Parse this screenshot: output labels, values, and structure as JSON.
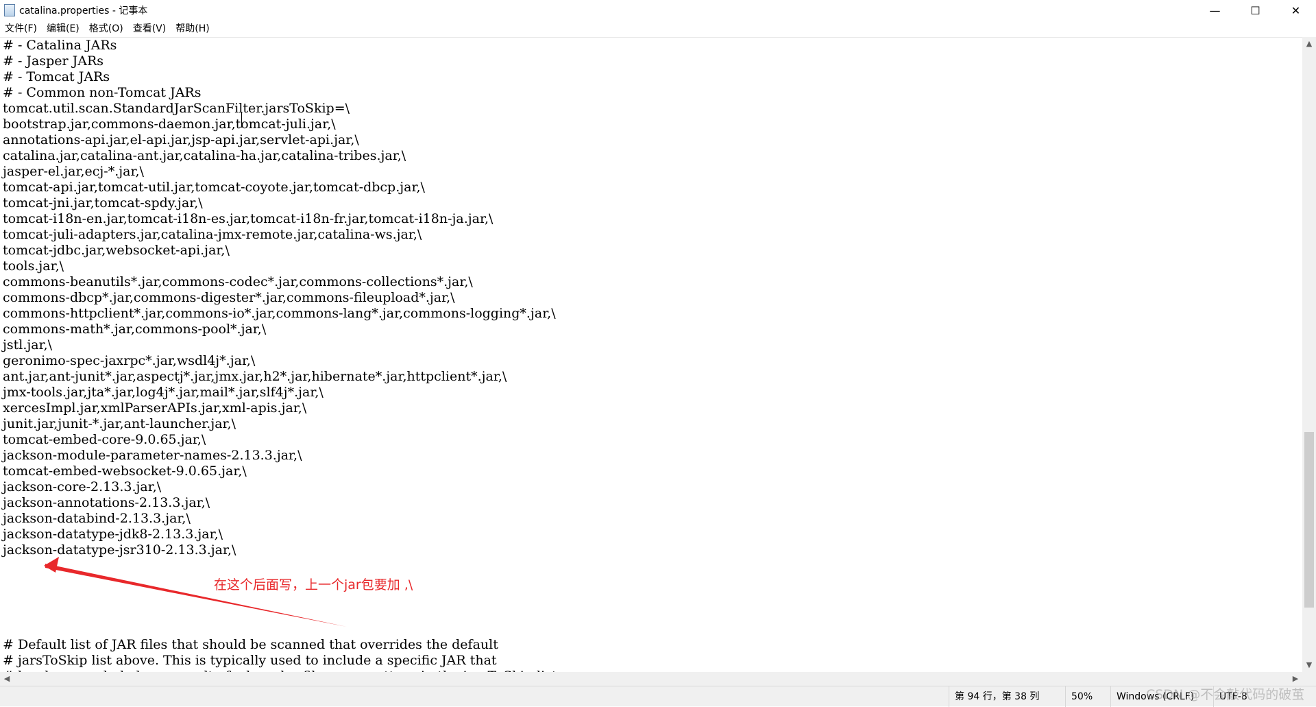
{
  "window": {
    "title": "catalina.properties - 记事本",
    "controls": {
      "minimize": "—",
      "maximize": "☐",
      "close": "✕"
    }
  },
  "menu": [
    {
      "label": "文件(F)"
    },
    {
      "label": "编辑(E)"
    },
    {
      "label": "格式(O)"
    },
    {
      "label": "查看(V)"
    },
    {
      "label": "帮助(H)"
    }
  ],
  "editor": {
    "lines": [
      "# - Catalina JARs",
      "# - Jasper JARs",
      "# - Tomcat JARs",
      "# - Common non-Tomcat JARs",
      "tomcat.util.scan.StandardJarScanFilter.jarsToSkip=\\",
      "bootstrap.jar,commons-daemon.jar,tomcat-juli.jar,\\",
      "annotations-api.jar,el-api.jar,jsp-api.jar,servlet-api.jar,\\",
      "catalina.jar,catalina-ant.jar,catalina-ha.jar,catalina-tribes.jar,\\",
      "jasper-el.jar,ecj-*.jar,\\",
      "tomcat-api.jar,tomcat-util.jar,tomcat-coyote.jar,tomcat-dbcp.jar,\\",
      "tomcat-jni.jar,tomcat-spdy.jar,\\",
      "tomcat-i18n-en.jar,tomcat-i18n-es.jar,tomcat-i18n-fr.jar,tomcat-i18n-ja.jar,\\",
      "tomcat-juli-adapters.jar,catalina-jmx-remote.jar,catalina-ws.jar,\\",
      "tomcat-jdbc.jar,websocket-api.jar,\\",
      "tools.jar,\\",
      "commons-beanutils*.jar,commons-codec*.jar,commons-collections*.jar,\\",
      "commons-dbcp*.jar,commons-digester*.jar,commons-fileupload*.jar,\\",
      "commons-httpclient*.jar,commons-io*.jar,commons-lang*.jar,commons-logging*.jar,\\",
      "commons-math*.jar,commons-pool*.jar,\\",
      "jstl.jar,\\",
      "geronimo-spec-jaxrpc*.jar,wsdl4j*.jar,\\",
      "ant.jar,ant-junit*.jar,aspectj*.jar,jmx.jar,h2*.jar,hibernate*.jar,httpclient*.jar,\\",
      "jmx-tools.jar,jta*.jar,log4j*.jar,mail*.jar,slf4j*.jar,\\",
      "xercesImpl.jar,xmlParserAPIs.jar,xml-apis.jar,\\",
      "junit.jar,junit-*.jar,ant-launcher.jar,\\",
      "tomcat-embed-core-9.0.65.jar,\\",
      "jackson-module-parameter-names-2.13.3.jar,\\",
      "tomcat-embed-websocket-9.0.65.jar,\\",
      "jackson-core-2.13.3.jar,\\",
      "jackson-annotations-2.13.3.jar,\\",
      "jackson-databind-2.13.3.jar,\\",
      "jackson-datatype-jdk8-2.13.3.jar,\\",
      "jackson-datatype-jsr310-2.13.3.jar,\\",
      "",
      "",
      "",
      "",
      "",
      "# Default list of JAR files that should be scanned that overrides the default",
      "# jarsToSkip list above. This is typically used to include a specific JAR that",
      "# has been excluded as a result of a broader file name pattern in the jarsToSkip list."
    ]
  },
  "annotation": {
    "text": "在这个后面写，上一个jar包要加 ,\\",
    "color": "#e8282b"
  },
  "scrollbar": {
    "up": "▲",
    "down": "▼",
    "left": "◀",
    "right": "▶"
  },
  "status": {
    "position": "第 94 行，第 38 列",
    "zoom": "50%",
    "line_ending": "Windows (CRLF)",
    "encoding": "UTF-8"
  },
  "watermark": "CSDN @不会敲代码的破茧"
}
